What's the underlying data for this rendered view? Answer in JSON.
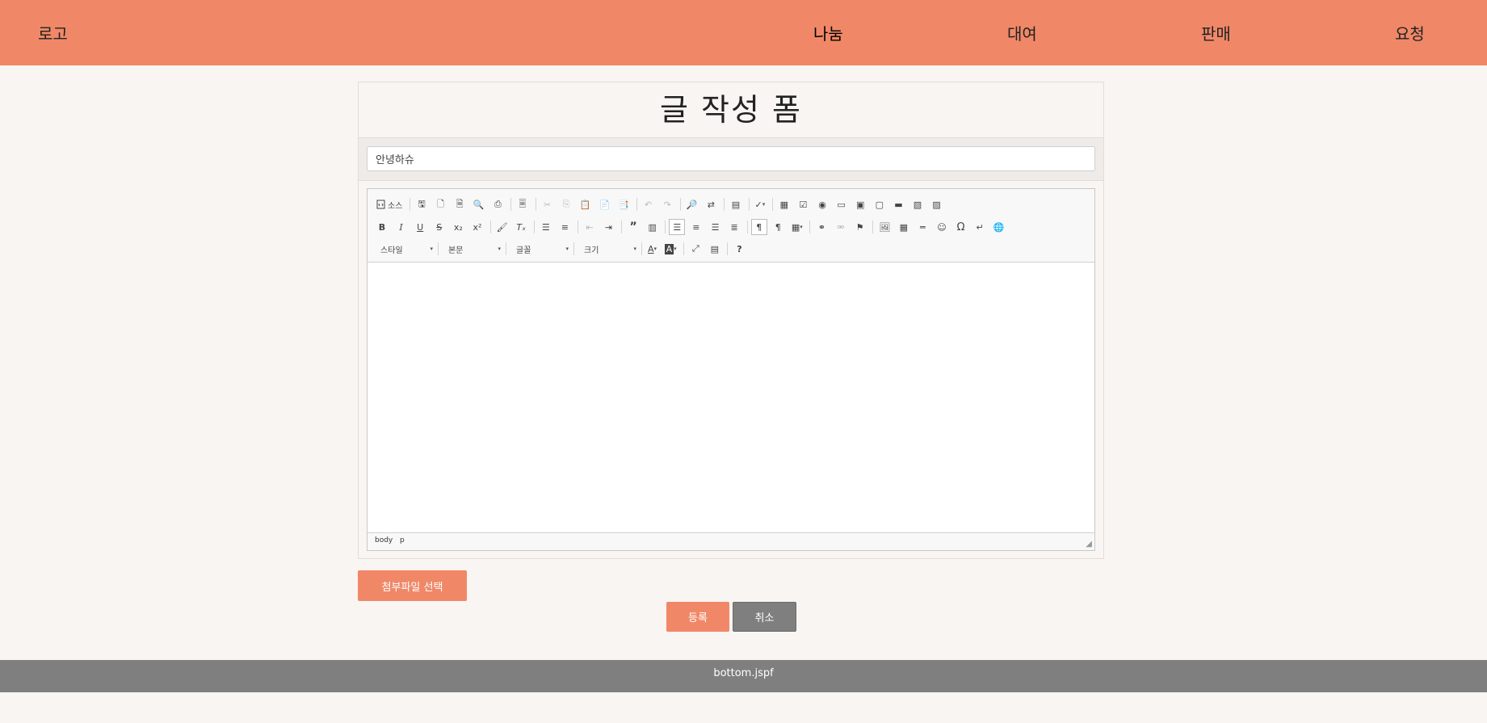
{
  "header": {
    "logo": "로고",
    "nav": [
      "나눔",
      "대여",
      "판매",
      "요청"
    ],
    "bg_color": "#f08868"
  },
  "form": {
    "title": "글 작성 폼",
    "title_input_value": "안녕하슈",
    "editor": {
      "source_label": "소스",
      "combos": {
        "style": "스타일",
        "format": "본문",
        "font": "글꼴",
        "size": "크기"
      },
      "statusbar": [
        "body",
        "p"
      ]
    },
    "attach_label": "첨부파일 선택",
    "submit_label": "등록",
    "cancel_label": "취소"
  },
  "footer": {
    "text": "bottom.jspf",
    "bg_color": "#7f7f7f"
  },
  "colors": {
    "accent": "#f08868",
    "page_bg": "#f9f5f2",
    "cancel": "#7f7f7f"
  }
}
